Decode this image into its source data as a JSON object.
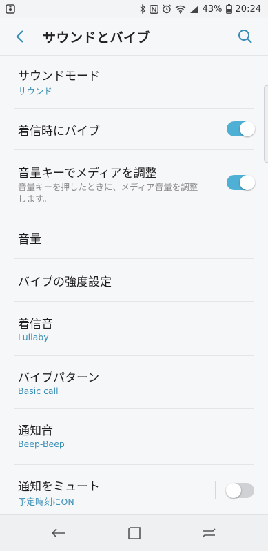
{
  "status_bar": {
    "battery_percent": "43%",
    "time": "20:24",
    "icons": [
      "media-icon",
      "bluetooth-icon",
      "nfc-icon",
      "alarm-icon",
      "wifi-icon",
      "signal-icon",
      "battery-icon"
    ]
  },
  "header": {
    "title": "サウンドとバイブ",
    "back_icon": "back-arrow-icon",
    "search_icon": "search-icon"
  },
  "colors": {
    "accent": "#3a8fb7",
    "toggle_on": "#4fb0d6",
    "toggle_off": "#cfd1d4"
  },
  "settings": [
    {
      "title": "サウンドモード",
      "subtitle": "サウンド"
    },
    {
      "title": "着信時にバイブ",
      "toggle": true
    },
    {
      "title": "音量キーでメディアを調整",
      "description": "音量キーを押したときに、メディア音量を調整します。",
      "toggle": true
    },
    {
      "title": "音量"
    },
    {
      "title": "バイブの強度設定"
    },
    {
      "title": "着信音",
      "subtitle": "Lullaby"
    },
    {
      "title": "バイブパターン",
      "subtitle": "Basic call"
    },
    {
      "title": "通知音",
      "subtitle": "Beep-Beep"
    },
    {
      "title": "通知をミュート",
      "subtitle": "予定時刻にON",
      "toggle": false
    }
  ],
  "nav_bar": {
    "icons": [
      "back-icon",
      "home-icon",
      "recents-icon"
    ]
  }
}
